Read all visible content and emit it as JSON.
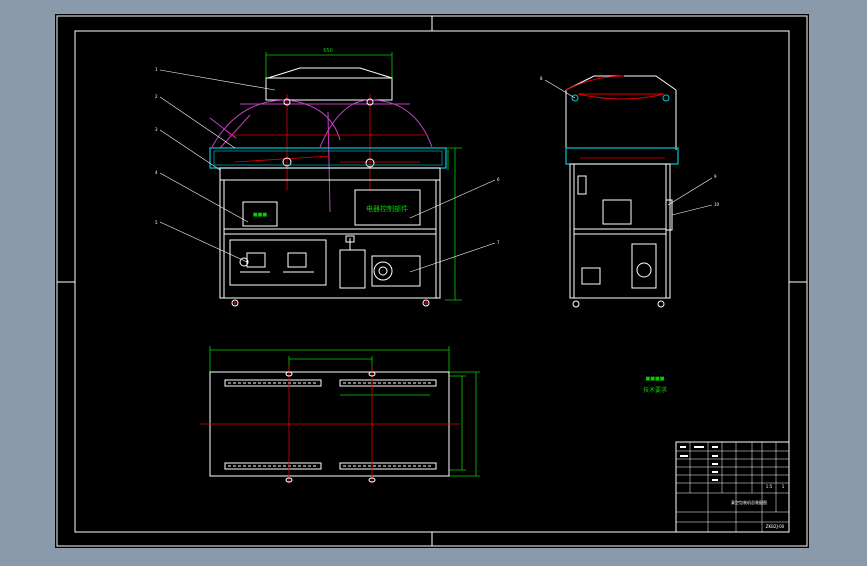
{
  "window": {
    "background": "#8a9aab",
    "canvas_color": "#000000"
  },
  "colors": {
    "frame": "#ffffff",
    "green": "#00d000",
    "red": "#e00000",
    "magenta": "#c040c0",
    "cyan": "#00c8d8",
    "white": "#ffffff"
  },
  "drawing": {
    "front_view_panel_label": "电器控制部件",
    "side_label": "总装配图",
    "note_label": "技术要求"
  },
  "title_block": {
    "drawing_name": "真空包装机总装配图",
    "drawing_number": "ZKBZJ-00",
    "scale": "1:5",
    "sheet": "1"
  }
}
